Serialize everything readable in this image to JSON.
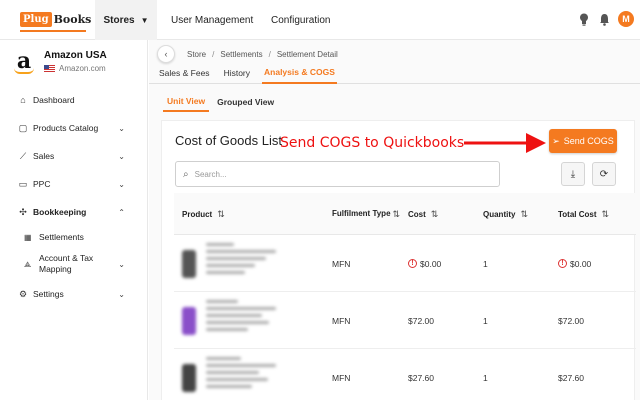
{
  "app": {
    "logo_part1": "Plug",
    "logo_part2": "Books",
    "nav": {
      "stores": "Stores",
      "user_management": "User Management",
      "configuration": "Configuration"
    },
    "avatar_initial": "M",
    "accent_color": "#f47a20"
  },
  "sidebar": {
    "store_name": "Amazon USA",
    "store_domain": "Amazon.com",
    "items": [
      {
        "label": "Dashboard",
        "icon": "home-icon"
      },
      {
        "label": "Products Catalog",
        "icon": "box-icon"
      },
      {
        "label": "Sales",
        "icon": "chart-icon"
      },
      {
        "label": "PPC",
        "icon": "ppc-icon"
      },
      {
        "label": "Bookkeeping",
        "icon": "book-icon"
      },
      {
        "label": "Settings",
        "icon": "gear-icon"
      }
    ],
    "sub_items": [
      {
        "label": "Settlements",
        "icon": "settlement-icon"
      },
      {
        "label": "Account & Tax Mapping",
        "icon": "tax-icon"
      }
    ]
  },
  "breadcrumb": [
    "Store",
    "Settlements",
    "Settlement Detail"
  ],
  "tabs": [
    "Sales & Fees",
    "History",
    "Analysis & COGS"
  ],
  "active_tab": "Analysis & COGS",
  "sub_tabs": [
    "Unit View",
    "Grouped View"
  ],
  "panel": {
    "title": "Cost of Goods List",
    "annotation": "Send COGS to Quickbooks",
    "send_button": "Send COGS",
    "search_placeholder": "Search..."
  },
  "table": {
    "columns": [
      "Product",
      "Fulfilment Type",
      "Cost",
      "Quantity",
      "Total Cost"
    ],
    "rows": [
      {
        "fulfilment": "MFN",
        "cost": "$0.00",
        "quantity": "1",
        "total": "$0.00",
        "warning": true
      },
      {
        "fulfilment": "MFN",
        "cost": "$72.00",
        "quantity": "1",
        "total": "$72.00",
        "warning": false
      },
      {
        "fulfilment": "MFN",
        "cost": "$27.60",
        "quantity": "1",
        "total": "$27.60",
        "warning": false
      }
    ]
  }
}
